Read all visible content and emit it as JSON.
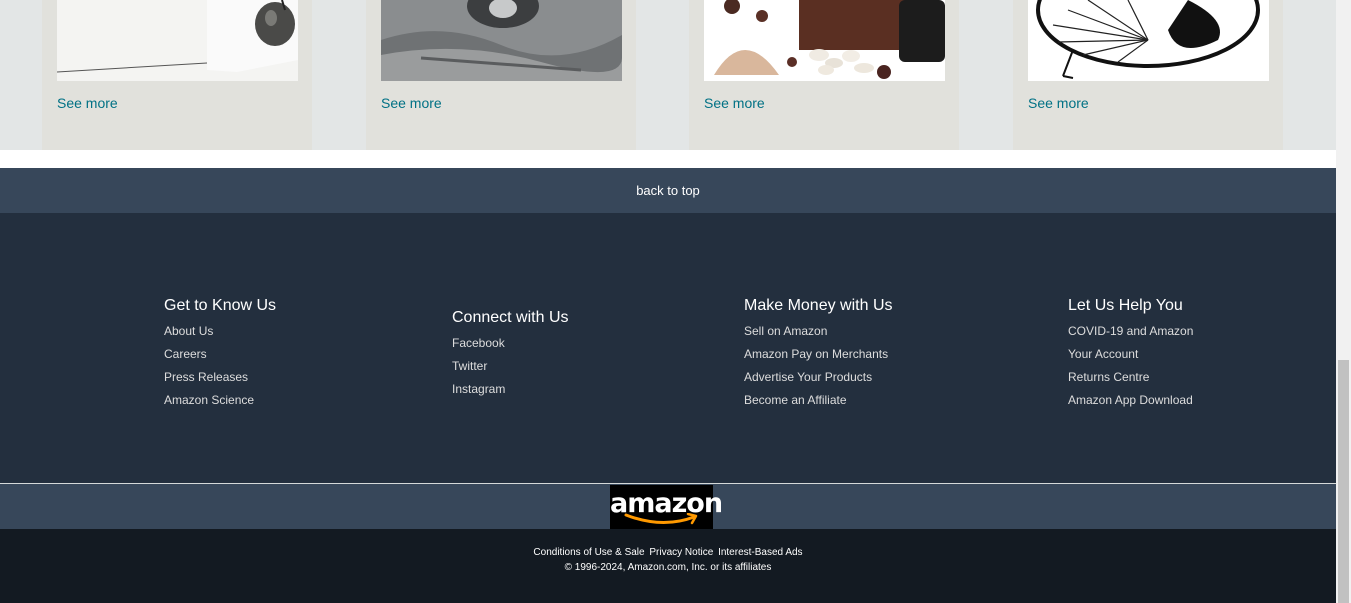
{
  "product_cards": [
    {
      "link_label": "See more",
      "image": "sculpture-stone-image"
    },
    {
      "link_label": "See more",
      "image": "kettlebell-image"
    },
    {
      "link_label": "See more",
      "image": "spices-image"
    },
    {
      "link_label": "See more",
      "image": "wire-chair-image"
    }
  ],
  "back_to_top": {
    "label": "back to top"
  },
  "footer": {
    "columns": [
      {
        "heading": "Get to Know Us",
        "links": [
          "About Us",
          "Careers",
          "Press Releases",
          "Amazon Science"
        ]
      },
      {
        "heading": "Connect with Us",
        "links": [
          "Facebook",
          "Twitter",
          "Instagram"
        ]
      },
      {
        "heading": "Make Money with Us",
        "links": [
          "Sell on Amazon",
          "Amazon Pay on Merchants",
          "Advertise Your Products",
          "Become an Affiliate"
        ]
      },
      {
        "heading": "Let Us Help You",
        "links": [
          "COVID-19 and Amazon",
          "Your Account",
          "Returns Centre",
          "Amazon App Download"
        ]
      }
    ],
    "logo_text": "amazon",
    "legal_links": [
      "Conditions of Use & Sale",
      "Privacy Notice",
      "Interest-Based Ads"
    ],
    "copyright": "© 1996-2024, Amazon.com, Inc. or its affiliates"
  },
  "colors": {
    "link_teal": "#007185",
    "nav_dark": "#232f3e",
    "nav_mid": "#37475a",
    "nav_darkest": "#131a22",
    "smile_orange": "#ff9900"
  }
}
